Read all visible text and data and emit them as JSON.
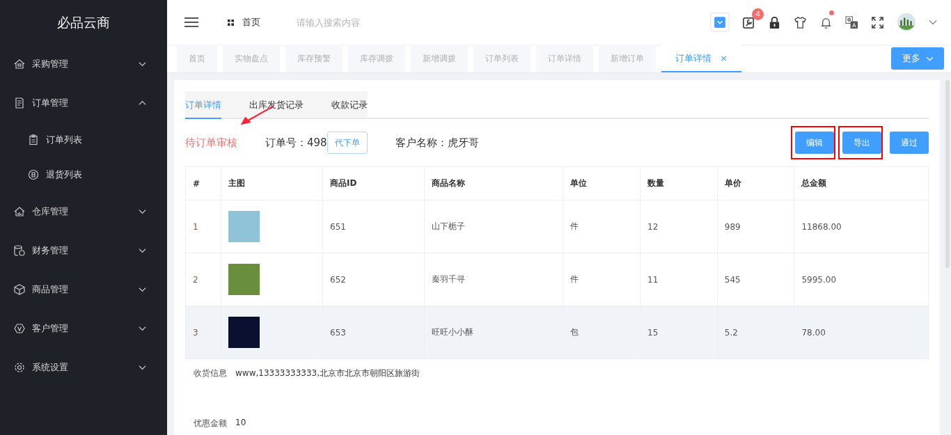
{
  "sidebar": {
    "logo": "必品云商",
    "items": [
      {
        "label": "采购管理",
        "expanded": false
      },
      {
        "label": "订单管理",
        "expanded": true,
        "children": [
          {
            "label": "订单列表"
          },
          {
            "label": "退货列表"
          }
        ]
      },
      {
        "label": "仓库管理",
        "expanded": false
      },
      {
        "label": "财务管理",
        "expanded": false
      },
      {
        "label": "商品管理",
        "expanded": false
      },
      {
        "label": "客户管理",
        "expanded": false
      },
      {
        "label": "系统设置",
        "expanded": false
      }
    ]
  },
  "header": {
    "breadcrumb": "首页",
    "search": {
      "placeholder": "请输入搜索内容"
    },
    "tool_badge": "4"
  },
  "tabs": [
    {
      "label": "首页",
      "selected": false
    },
    {
      "label": "实物盘点",
      "selected": false
    },
    {
      "label": "库存预警",
      "selected": false
    },
    {
      "label": "库存调拨",
      "selected": false
    },
    {
      "label": "新增调拨",
      "selected": false
    },
    {
      "label": "订单列表",
      "selected": false
    },
    {
      "label": "订单详情",
      "selected": false
    },
    {
      "label": "新增订单",
      "selected": false
    },
    {
      "label": "订单详情",
      "selected": true,
      "close": "×"
    }
  ],
  "more_button": "更多",
  "sub_tabs": [
    {
      "label": "订单详情",
      "selected": true
    },
    {
      "label": "出库发货记录",
      "selected": false
    },
    {
      "label": "收款记录",
      "selected": false
    }
  ],
  "order": {
    "status": "待订单审核",
    "status_arrow": true,
    "order_no": "订单号：498",
    "proxy_button": "代下单",
    "customer": "客户名称：虎牙哥"
  },
  "actions": [
    {
      "label": "编辑",
      "annotated": true
    },
    {
      "label": "导出",
      "annotated": true
    },
    {
      "label": "通过",
      "annotated": false
    }
  ],
  "table": {
    "columns": [
      "#",
      "主图",
      "商品ID",
      "商品名称",
      "单位",
      "数量",
      "单价",
      "总金额"
    ],
    "rows": [
      {
        "index": "1",
        "product_id": "651",
        "name": "山下栀子",
        "unit": "件",
        "qty": "12",
        "price": "989",
        "total": "11868.00",
        "hovered": false
      },
      {
        "index": "2",
        "product_id": "652",
        "name": "秦羽千寻",
        "unit": "件",
        "qty": "11",
        "price": "545",
        "total": "5995.00",
        "hovered": false
      },
      {
        "index": "3",
        "product_id": "653",
        "name": "旺旺小小酥",
        "unit": "包",
        "qty": "15",
        "price": "5.2",
        "total": "78.00",
        "hovered": true
      }
    ]
  },
  "info": [
    {
      "label": "收货信息",
      "value": "www,13333333333,北京市北京市朝阳区旅游街"
    },
    {
      "label": "优惠金额",
      "value": "10"
    }
  ]
}
